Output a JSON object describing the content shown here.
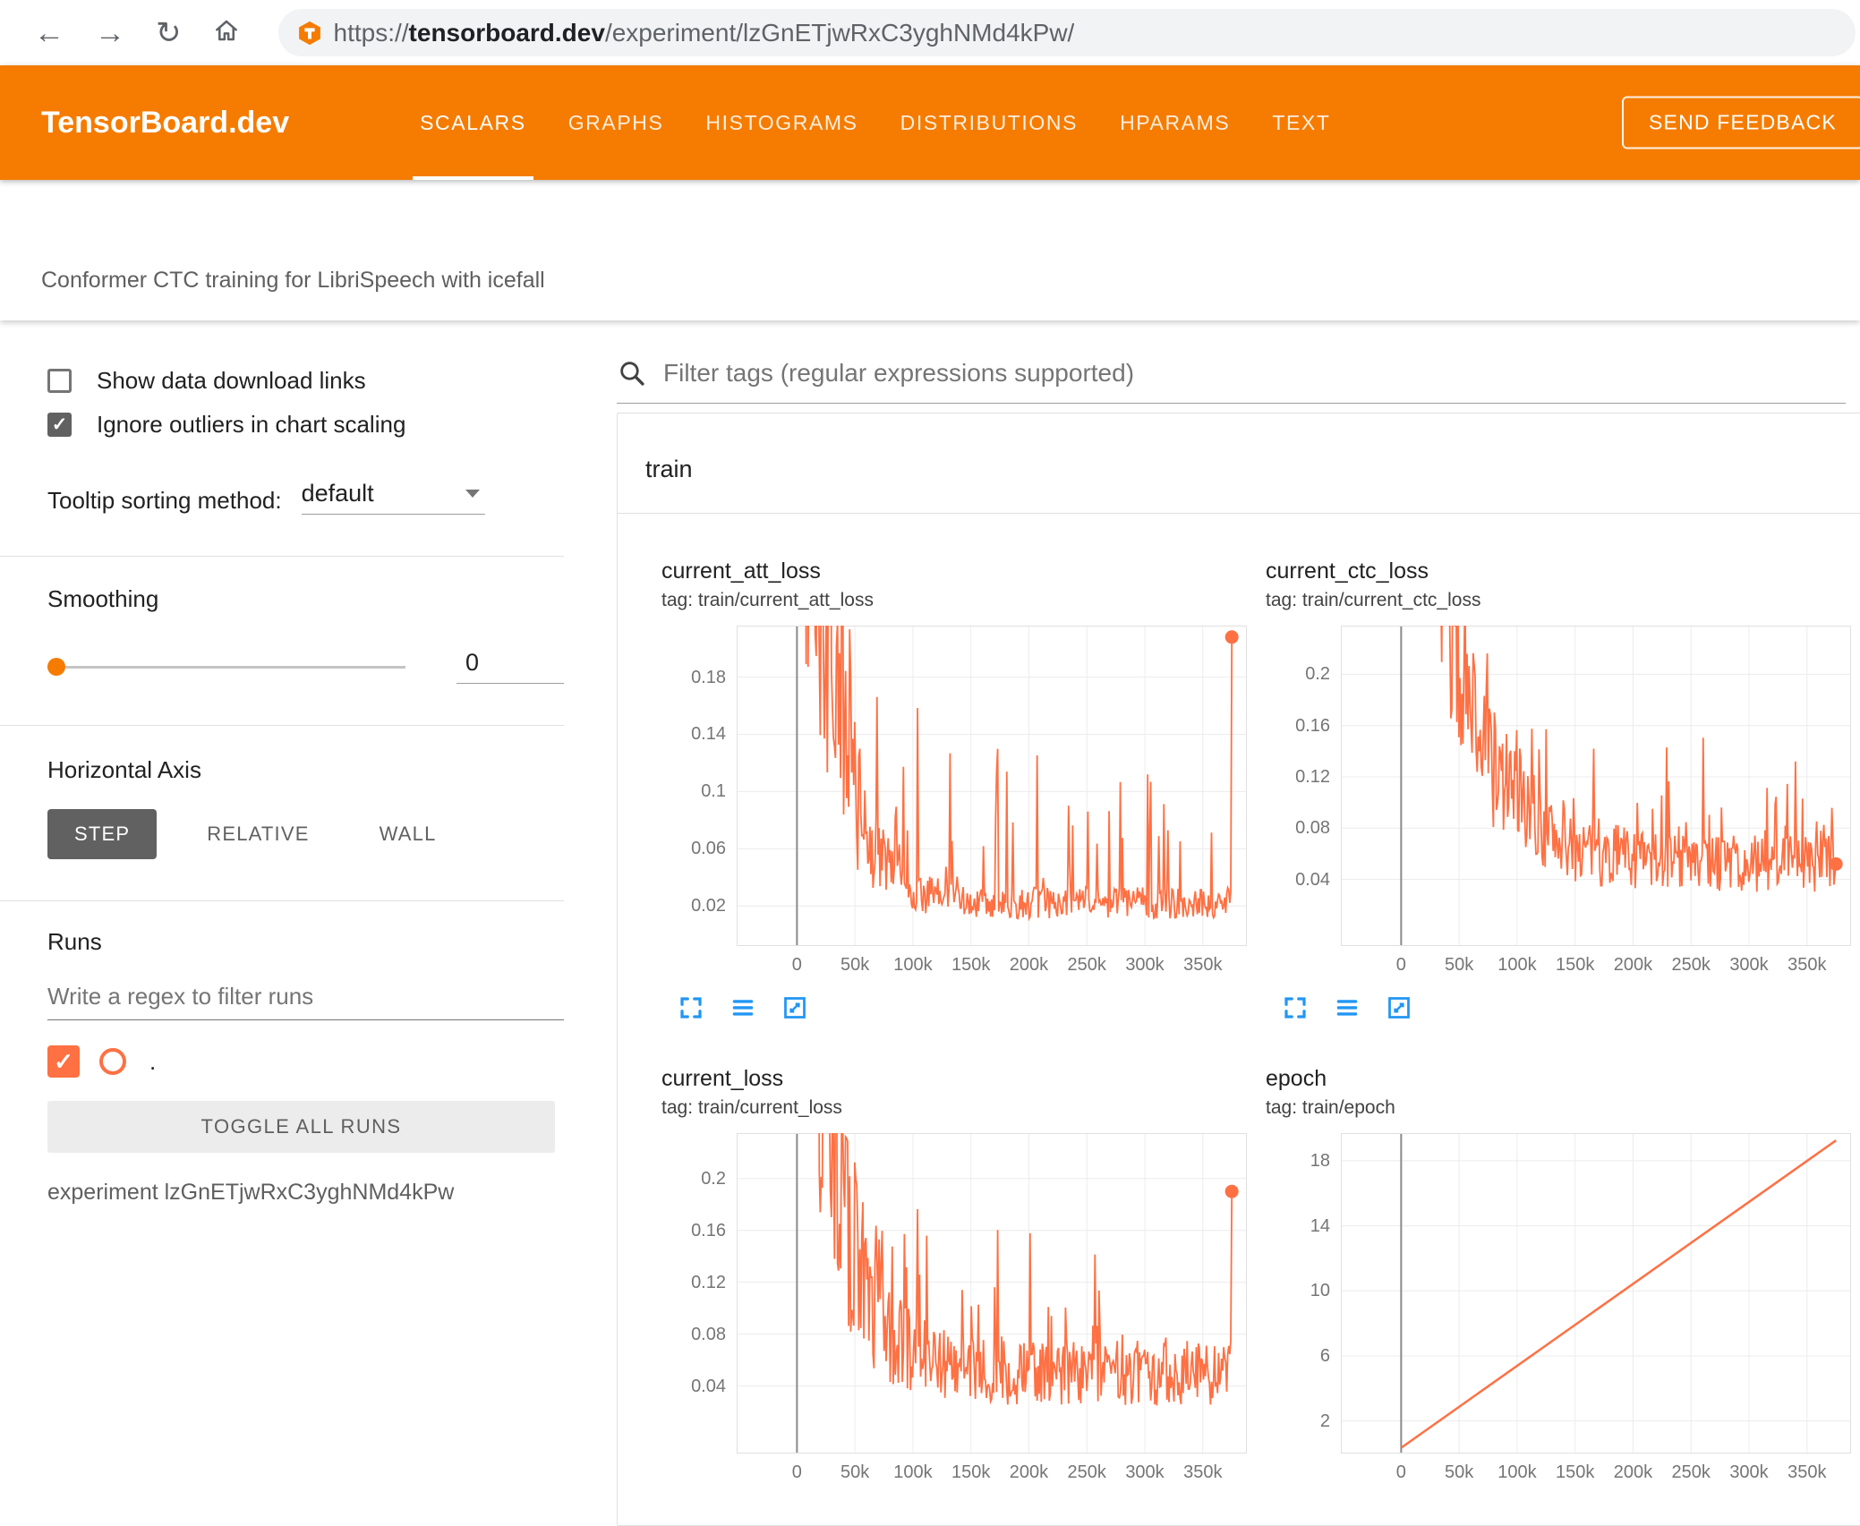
{
  "browser": {
    "url_scheme": "https://",
    "url_domain": "tensorboard.dev",
    "url_path": "/experiment/lzGnETjwRxC3yghNMd4kPw/"
  },
  "header": {
    "logo": "TensorBoard.dev",
    "tabs": [
      {
        "label": "SCALARS",
        "active": true
      },
      {
        "label": "GRAPHS",
        "active": false
      },
      {
        "label": "HISTOGRAMS",
        "active": false
      },
      {
        "label": "DISTRIBUTIONS",
        "active": false
      },
      {
        "label": "HPARAMS",
        "active": false
      },
      {
        "label": "TEXT",
        "active": false
      }
    ],
    "feedback_button": "SEND FEEDBACK"
  },
  "experiment": {
    "title": "Conformer CTC training for LibriSpeech with icefall"
  },
  "sidebar": {
    "show_download": {
      "label": "Show data download links",
      "checked": false
    },
    "ignore_outliers": {
      "label": "Ignore outliers in chart scaling",
      "checked": true
    },
    "tooltip_sorting": {
      "label": "Tooltip sorting method:",
      "value": "default"
    },
    "smoothing": {
      "label": "Smoothing",
      "value": "0"
    },
    "horizontal_axis": {
      "label": "Horizontal Axis",
      "options": [
        "STEP",
        "RELATIVE",
        "WALL"
      ],
      "selected": "STEP"
    },
    "runs": {
      "label": "Runs",
      "filter_placeholder": "Write a regex to filter runs",
      "run_checked": true,
      "run_label": ".",
      "toggle_button": "TOGGLE ALL RUNS",
      "experiment_caption": "experiment lzGnETjwRxC3yghNMd4kPw"
    }
  },
  "main": {
    "filter_placeholder": "Filter tags (regular expressions supported)",
    "group_label": "train"
  },
  "colors": {
    "accent_orange": "#f57c00",
    "run_line": "#ff7043",
    "chart_icon_blue": "#2196f3"
  },
  "chart_data": [
    {
      "type": "line",
      "title": "current_att_loss",
      "tag": "tag: train/current_att_loss",
      "x_range": [
        -52000,
        388000
      ],
      "x_ticks": [
        {
          "v": 0,
          "label": "0"
        },
        {
          "v": 50000,
          "label": "50k"
        },
        {
          "v": 100000,
          "label": "100k"
        },
        {
          "v": 150000,
          "label": "150k"
        },
        {
          "v": 200000,
          "label": "200k"
        },
        {
          "v": 250000,
          "label": "250k"
        },
        {
          "v": 300000,
          "label": "300k"
        },
        {
          "v": 350000,
          "label": "350k"
        }
      ],
      "y_range": [
        -0.008,
        0.216
      ],
      "y_ticks": [
        {
          "v": 0.02,
          "label": "0.02"
        },
        {
          "v": 0.06,
          "label": "0.06"
        },
        {
          "v": 0.1,
          "label": "0.1"
        },
        {
          "v": 0.14,
          "label": "0.14"
        },
        {
          "v": 0.18,
          "label": "0.18"
        }
      ],
      "color": "#ff7043",
      "icons": true,
      "end_dot": {
        "x": 375000,
        "y": 0.208
      },
      "trend_points": [
        [
          5000,
          0.3
        ],
        [
          20000,
          0.15
        ],
        [
          50000,
          0.07
        ],
        [
          100000,
          0.035
        ],
        [
          150000,
          0.028
        ],
        [
          200000,
          0.026
        ],
        [
          250000,
          0.025
        ],
        [
          300000,
          0.024
        ],
        [
          375000,
          0.022
        ]
      ],
      "series_gen": {
        "start": 0.5,
        "floor": 0.022,
        "tau": 26000,
        "noise": 0.5,
        "spike_prob": 0.2,
        "spike_max": 0.17,
        "late_factor": 0.5,
        "seed": 42,
        "points": 430,
        "x_max": 375000
      }
    },
    {
      "type": "line",
      "title": "current_ctc_loss",
      "tag": "tag: train/current_ctc_loss",
      "x_range": [
        -52000,
        388000
      ],
      "x_ticks": [
        {
          "v": 0,
          "label": "0"
        },
        {
          "v": 50000,
          "label": "50k"
        },
        {
          "v": 100000,
          "label": "100k"
        },
        {
          "v": 150000,
          "label": "150k"
        },
        {
          "v": 200000,
          "label": "200k"
        },
        {
          "v": 250000,
          "label": "250k"
        },
        {
          "v": 300000,
          "label": "300k"
        },
        {
          "v": 350000,
          "label": "350k"
        }
      ],
      "y_range": [
        -0.012,
        0.238
      ],
      "y_ticks": [
        {
          "v": 0.04,
          "label": "0.04"
        },
        {
          "v": 0.08,
          "label": "0.08"
        },
        {
          "v": 0.12,
          "label": "0.12"
        },
        {
          "v": 0.16,
          "label": "0.16"
        },
        {
          "v": 0.2,
          "label": "0.2"
        }
      ],
      "color": "#ff7043",
      "icons": true,
      "end_dot": {
        "x": 375000,
        "y": 0.052
      },
      "trend_points": [
        [
          5000,
          0.4
        ],
        [
          20000,
          0.22
        ],
        [
          50000,
          0.12
        ],
        [
          100000,
          0.075
        ],
        [
          150000,
          0.062
        ],
        [
          200000,
          0.057
        ],
        [
          250000,
          0.054
        ],
        [
          300000,
          0.052
        ],
        [
          375000,
          0.05
        ]
      ],
      "series_gen": {
        "start": 0.55,
        "floor": 0.052,
        "tau": 42000,
        "noise": 0.42,
        "spike_prob": 0.2,
        "spike_max": 0.13,
        "late_factor": 0.55,
        "seed": 7,
        "points": 430,
        "x_max": 375000
      }
    },
    {
      "type": "line",
      "title": "current_loss",
      "tag": "tag: train/current_loss",
      "x_range": [
        -52000,
        388000
      ],
      "x_ticks": [
        {
          "v": 0,
          "label": "0"
        },
        {
          "v": 50000,
          "label": "50k"
        },
        {
          "v": 100000,
          "label": "100k"
        },
        {
          "v": 150000,
          "label": "150k"
        },
        {
          "v": 200000,
          "label": "200k"
        },
        {
          "v": 250000,
          "label": "250k"
        },
        {
          "v": 300000,
          "label": "300k"
        },
        {
          "v": 350000,
          "label": "350k"
        }
      ],
      "y_range": [
        -0.012,
        0.235
      ],
      "y_ticks": [
        {
          "v": 0.04,
          "label": "0.04"
        },
        {
          "v": 0.08,
          "label": "0.08"
        },
        {
          "v": 0.12,
          "label": "0.12"
        },
        {
          "v": 0.16,
          "label": "0.16"
        },
        {
          "v": 0.2,
          "label": "0.2"
        }
      ],
      "color": "#ff7043",
      "icons": false,
      "end_dot": {
        "x": 375000,
        "y": 0.19
      },
      "trend_points": [
        [
          5000,
          0.45
        ],
        [
          20000,
          0.2
        ],
        [
          50000,
          0.11
        ],
        [
          100000,
          0.06
        ],
        [
          150000,
          0.055
        ],
        [
          200000,
          0.052
        ],
        [
          250000,
          0.05
        ],
        [
          300000,
          0.05
        ],
        [
          375000,
          0.05
        ]
      ],
      "series_gen": {
        "start": 0.6,
        "floor": 0.05,
        "tau": 28000,
        "noise": 0.5,
        "spike_prob": 0.2,
        "spike_max": 0.15,
        "late_factor": 0.5,
        "seed": 13,
        "points": 430,
        "x_max": 375000
      }
    },
    {
      "type": "line",
      "title": "epoch",
      "tag": "tag: train/epoch",
      "x_range": [
        -52000,
        388000
      ],
      "x_ticks": [
        {
          "v": 0,
          "label": "0"
        },
        {
          "v": 50000,
          "label": "50k"
        },
        {
          "v": 100000,
          "label": "100k"
        },
        {
          "v": 150000,
          "label": "150k"
        },
        {
          "v": 200000,
          "label": "200k"
        },
        {
          "v": 250000,
          "label": "250k"
        },
        {
          "v": 300000,
          "label": "300k"
        },
        {
          "v": 350000,
          "label": "350k"
        }
      ],
      "y_range": [
        0,
        19.7
      ],
      "y_ticks": [
        {
          "v": 2,
          "label": "2"
        },
        {
          "v": 6,
          "label": "6"
        },
        {
          "v": 10,
          "label": "10"
        },
        {
          "v": 14,
          "label": "14"
        },
        {
          "v": 18,
          "label": "18"
        }
      ],
      "color": "#ff7043",
      "icons": false,
      "points": [
        [
          0,
          0.35
        ],
        [
          375000,
          19.25
        ]
      ],
      "trend_points": [
        [
          0,
          0.35
        ],
        [
          375000,
          19.25
        ]
      ]
    }
  ]
}
